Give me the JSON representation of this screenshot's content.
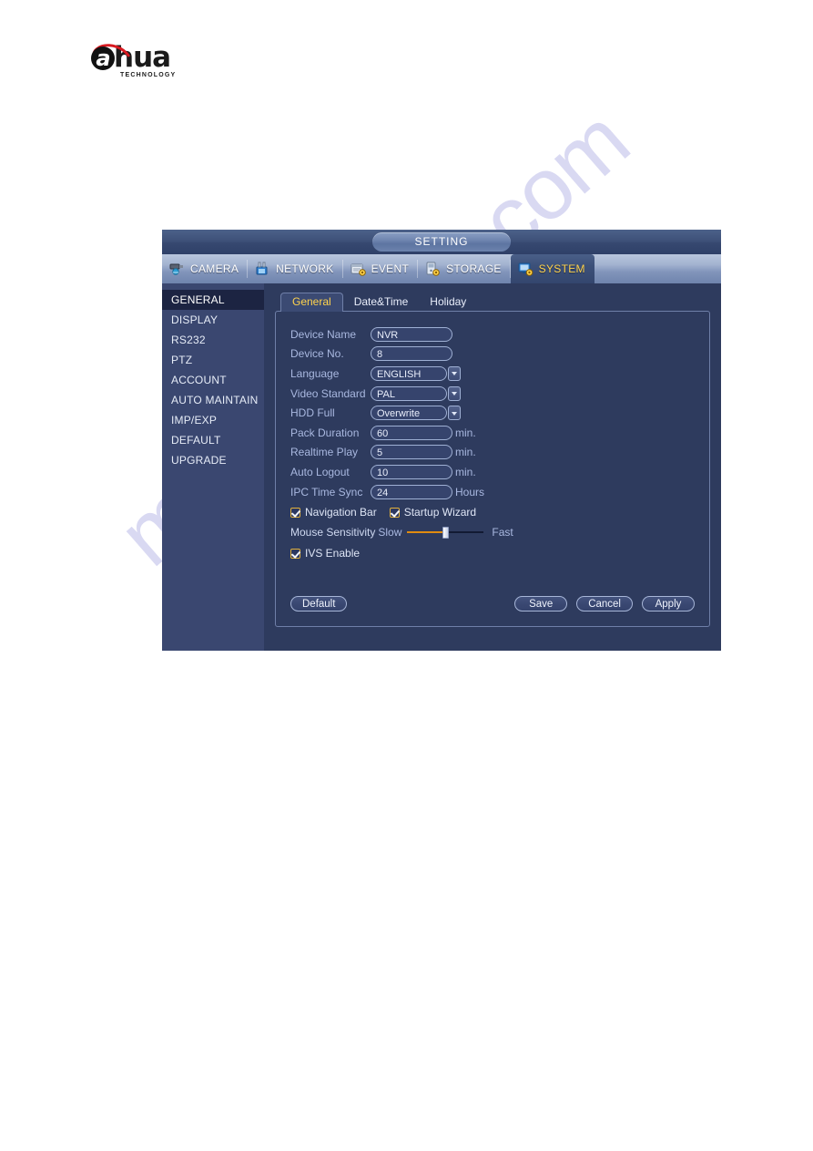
{
  "brand": {
    "logo_text": "alhua",
    "logo_letter": "a",
    "logo_rest": "hua",
    "logo_sub": "TECHNOLOGY"
  },
  "watermark": {
    "text": "manualshire.com"
  },
  "window": {
    "title": "SETTING",
    "tabs": [
      {
        "label": "CAMERA",
        "icon": "camera-icon",
        "active": false
      },
      {
        "label": "NETWORK",
        "icon": "network-icon",
        "active": false
      },
      {
        "label": "EVENT",
        "icon": "event-icon",
        "active": false
      },
      {
        "label": "STORAGE",
        "icon": "storage-icon",
        "active": false
      },
      {
        "label": "SYSTEM",
        "icon": "system-icon",
        "active": true
      }
    ]
  },
  "sidebar": {
    "items": [
      {
        "label": "GENERAL",
        "active": true
      },
      {
        "label": "DISPLAY",
        "active": false
      },
      {
        "label": "RS232",
        "active": false
      },
      {
        "label": "PTZ",
        "active": false
      },
      {
        "label": "ACCOUNT",
        "active": false
      },
      {
        "label": "AUTO MAINTAIN",
        "active": false
      },
      {
        "label": "IMP/EXP",
        "active": false
      },
      {
        "label": "DEFAULT",
        "active": false
      },
      {
        "label": "UPGRADE",
        "active": false
      }
    ]
  },
  "subtabs": [
    {
      "label": "General",
      "active": true
    },
    {
      "label": "Date&Time",
      "active": false
    },
    {
      "label": "Holiday",
      "active": false
    }
  ],
  "form": {
    "device_name": {
      "label": "Device Name",
      "value": "NVR",
      "suffix": ""
    },
    "device_no": {
      "label": "Device No.",
      "value": "8",
      "suffix": ""
    },
    "language": {
      "label": "Language",
      "value": "ENGLISH",
      "suffix": ""
    },
    "video_standard": {
      "label": "Video Standard",
      "value": "PAL",
      "suffix": ""
    },
    "hdd_full": {
      "label": "HDD Full",
      "value": "Overwrite",
      "suffix": ""
    },
    "pack_duration": {
      "label": "Pack Duration",
      "value": "60",
      "suffix": "min."
    },
    "realtime_play": {
      "label": "Realtime Play",
      "value": "5",
      "suffix": "min."
    },
    "auto_logout": {
      "label": "Auto Logout",
      "value": "10",
      "suffix": "min."
    },
    "ipc_time_sync": {
      "label": "IPC Time Sync",
      "value": "24",
      "suffix": "Hours"
    },
    "navigation_bar": {
      "label": "Navigation Bar",
      "checked": true
    },
    "startup_wizard": {
      "label": "Startup Wizard",
      "checked": true
    },
    "mouse_sensitivity": {
      "label": "Mouse Sensitivity",
      "min_label": "Slow",
      "max_label": "Fast",
      "percent": 48
    },
    "ivs_enable": {
      "label": "IVS Enable",
      "checked": true
    }
  },
  "buttons": {
    "default": "Default",
    "save": "Save",
    "cancel": "Cancel",
    "apply": "Apply"
  },
  "colors": {
    "window_bg": "#2e3b5e",
    "sidebar_bg": "#3a4770",
    "sidebar_active_bg": "#1c2442",
    "accent_yellow": "#ffd34d",
    "label_blue": "#a9b8e0",
    "slider_orange": "#e08c10",
    "logo_red": "#d71920",
    "watermark": "#d9d9f2"
  }
}
